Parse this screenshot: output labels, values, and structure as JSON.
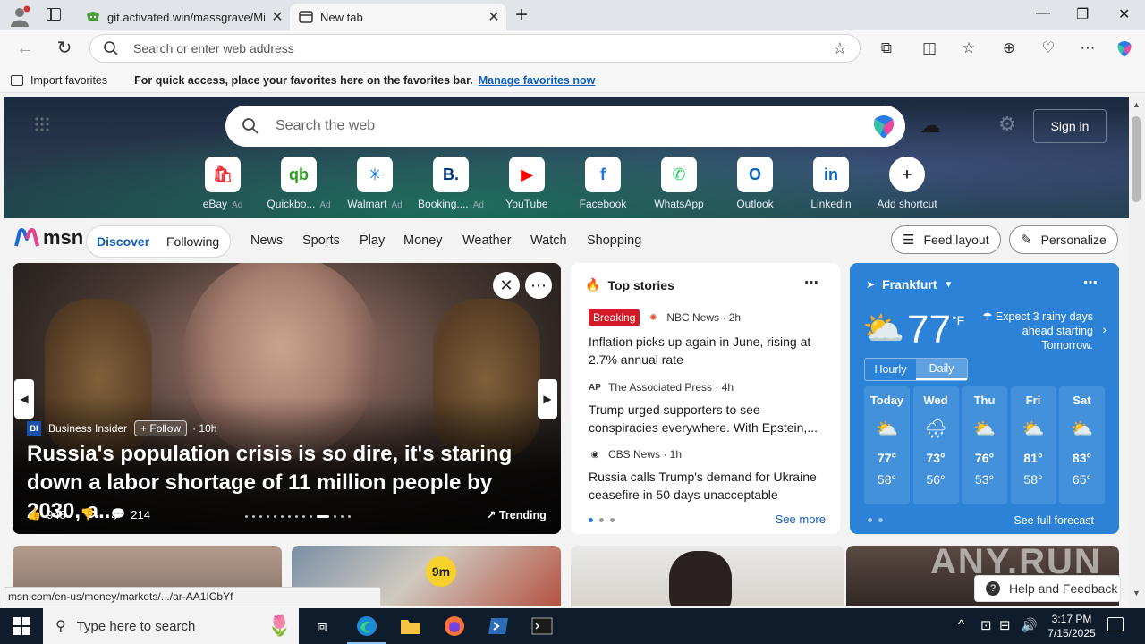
{
  "browser": {
    "tabs": [
      {
        "title": "git.activated.win/massgrave/Micr"
      },
      {
        "title": "New tab"
      }
    ],
    "address_placeholder": "Search or enter web address",
    "favorites_bar": {
      "import_label": "Import favorites",
      "message": "For quick access, place your favorites here on the favorites bar.",
      "link": "Manage favorites now"
    },
    "status_url": "msn.com/en-us/money/markets/.../ar-AA1ICbYf"
  },
  "newtab": {
    "search_placeholder": "Search the web",
    "sign_in": "Sign in",
    "shortcuts": [
      {
        "label": "eBay",
        "ad": "Ad",
        "icon": "ebay-icon",
        "color": "#e53238"
      },
      {
        "label": "Quickbo...",
        "ad": "Ad",
        "icon": "quickbooks-icon",
        "color": "#2ca01c"
      },
      {
        "label": "Walmart",
        "ad": "Ad",
        "icon": "walmart-icon",
        "color": "#0071ce"
      },
      {
        "label": "Booking....",
        "ad": "Ad",
        "icon": "booking-icon",
        "color": "#003580"
      },
      {
        "label": "YouTube",
        "ad": "",
        "icon": "youtube-icon",
        "color": "#ff0000"
      },
      {
        "label": "Facebook",
        "ad": "",
        "icon": "facebook-icon",
        "color": "#1877f2"
      },
      {
        "label": "WhatsApp",
        "ad": "",
        "icon": "whatsapp-icon",
        "color": "#25d366"
      },
      {
        "label": "Outlook",
        "ad": "",
        "icon": "outlook-icon",
        "color": "#0a64b8"
      },
      {
        "label": "LinkedIn",
        "ad": "",
        "icon": "linkedin-icon",
        "color": "#0a66c2"
      },
      {
        "label": "Add shortcut",
        "ad": "",
        "icon": "plus-icon",
        "color": "#333333"
      }
    ],
    "shortcut_glyphs": [
      "🛍",
      "qb",
      "✳",
      "B.",
      "▶",
      "f",
      "✆",
      "O",
      "in",
      "+"
    ]
  },
  "msn": {
    "logo": "msn",
    "pill": {
      "discover": "Discover",
      "following": "Following"
    },
    "nav": [
      "News",
      "Sports",
      "Play",
      "Money",
      "Weather",
      "Watch",
      "Shopping"
    ],
    "feed_layout": "Feed layout",
    "personalize": "Personalize"
  },
  "main_story": {
    "source": "Business Insider",
    "source_abbr": "BI",
    "follow": "Follow",
    "age": "· 10h",
    "headline": "Russia's population crisis is so dire, it's staring down a labor shortage of 11 million people by 2030, a...",
    "likes": "948",
    "comments": "214",
    "trending": "Trending"
  },
  "top_stories": {
    "title": "Top stories",
    "items": [
      {
        "badge": "Breaking",
        "source": "NBC News · 2h",
        "title": "Inflation picks up again in June, rising at 2.7% annual rate"
      },
      {
        "badge": "",
        "source": "The Associated Press · 4h",
        "title": "Trump urged supporters to see conspiracies everywhere. With Epstein,..."
      },
      {
        "badge": "",
        "source": "CBS News · 1h",
        "title": "Russia calls Trump's demand for Ukraine ceasefire in 50 days unacceptable"
      }
    ],
    "see_more": "See more"
  },
  "weather": {
    "location": "Frankfurt",
    "temp": "77",
    "unit": "°F",
    "alert": "Expect 3 rainy days ahead starting Tomorrow.",
    "toggle": {
      "hourly": "Hourly",
      "daily": "Daily"
    },
    "days": [
      {
        "name": "Today",
        "hi": "77°",
        "lo": "58°",
        "icon": "partly-sunny-icon"
      },
      {
        "name": "Wed",
        "hi": "73°",
        "lo": "56°",
        "icon": "rain-icon"
      },
      {
        "name": "Thu",
        "hi": "76°",
        "lo": "53°",
        "icon": "partly-sunny-icon"
      },
      {
        "name": "Fri",
        "hi": "81°",
        "lo": "58°",
        "icon": "partly-sunny-icon"
      },
      {
        "name": "Sat",
        "hi": "83°",
        "lo": "65°",
        "icon": "partly-sunny-icon"
      }
    ],
    "see_full": "See full forecast"
  },
  "lower": {
    "timer": "9m"
  },
  "help": "Help and Feedback",
  "watermark": "ANY.RUN",
  "taskbar": {
    "search_placeholder": "Type here to search",
    "time": "3:17 PM",
    "date": "7/15/2025"
  }
}
